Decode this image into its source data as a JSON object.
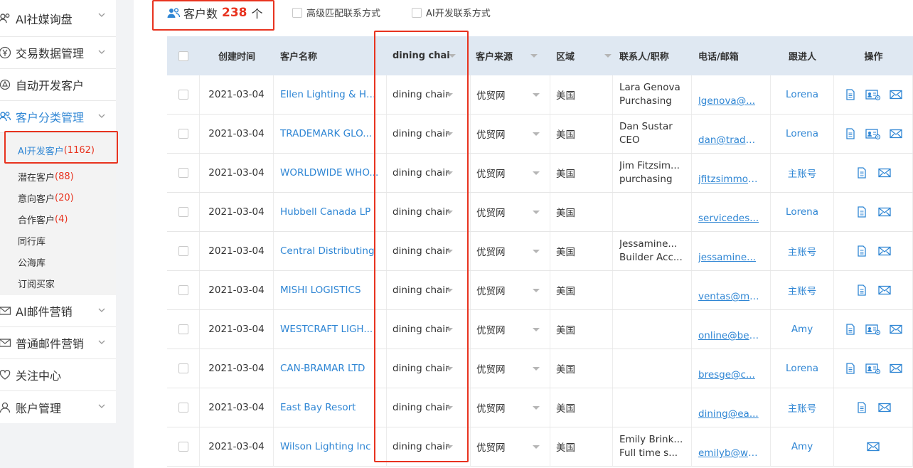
{
  "sidebar": {
    "items": [
      {
        "label": "AI社媒询盘",
        "icon": "users-icon"
      },
      {
        "label": "交易数据管理",
        "icon": "yen-icon"
      },
      {
        "label": "自动开发客户",
        "icon": "refresh-icon"
      },
      {
        "label": "客户分类管理",
        "icon": "group-icon"
      },
      {
        "label": "AI邮件营销",
        "icon": "mail-icon"
      },
      {
        "label": "普通邮件营销",
        "icon": "mail-icon"
      },
      {
        "label": "关注中心",
        "icon": "heart-icon"
      },
      {
        "label": "账户管理",
        "icon": "user-icon"
      }
    ],
    "sub_items": [
      {
        "label": "AI开发客户",
        "count": "(1162)"
      },
      {
        "label": "潜在客户",
        "count": "(88)"
      },
      {
        "label": "意向客户",
        "count": "(20)"
      },
      {
        "label": "合作客户",
        "count": "(4)"
      },
      {
        "label": "同行库",
        "count": ""
      },
      {
        "label": "公海库",
        "count": ""
      },
      {
        "label": "订阅买家",
        "count": ""
      }
    ]
  },
  "topbar": {
    "count_prefix": "客户数",
    "count_value": "238",
    "count_suffix": "个",
    "option1": "高级匹配联系方式",
    "option2": "AI开发联系方式"
  },
  "table": {
    "headers": [
      "创建时间",
      "客户名称",
      "dining chai",
      "客户来源",
      "区域",
      "联系人/职称",
      "电话/邮箱",
      "跟进人",
      "操作"
    ],
    "rows": [
      {
        "date": "2021-03-04",
        "name": "Ellen Lighting & Har...",
        "category": "dining chair",
        "source": "优贸网",
        "region": "美国",
        "contact": "Lara Genova",
        "title": "Purchasing",
        "email": "lgenova@...",
        "follower": "Lorena",
        "actions": [
          "doc-icon",
          "card-icon",
          "mail-icon"
        ]
      },
      {
        "date": "2021-03-04",
        "name": "TRADEMARK GLO...",
        "category": "dining chair",
        "source": "优贸网",
        "region": "美国",
        "contact": "Dan Sustar",
        "title": "CEO",
        "email": "dan@trade...",
        "follower": "Lorena",
        "actions": [
          "doc-icon",
          "card-icon",
          "mail-icon"
        ]
      },
      {
        "date": "2021-03-04",
        "name": "WORLDWIDE WHO...",
        "category": "dining chair",
        "source": "优贸网",
        "region": "美国",
        "contact": "Jim Fitzsim...",
        "title": "purchasing",
        "email": "jfitzsimmon...",
        "follower": "主账号",
        "actions": [
          "doc-icon",
          "mail-icon"
        ]
      },
      {
        "date": "2021-03-04",
        "name": "Hubbell Canada LP",
        "category": "dining chair",
        "source": "优贸网",
        "region": "美国",
        "contact": "",
        "title": "",
        "email": "servicedes...",
        "follower": "Lorena",
        "actions": [
          "doc-icon",
          "mail-icon"
        ]
      },
      {
        "date": "2021-03-04",
        "name": "Central Distributing",
        "category": "dining chair",
        "source": "优贸网",
        "region": "美国",
        "contact": "Jessamine...",
        "title": "Builder Acc...",
        "email": "jessamine...",
        "follower": "主账号",
        "actions": [
          "doc-icon",
          "mail-icon"
        ]
      },
      {
        "date": "2021-03-04",
        "name": "MISHI LOGISTICS",
        "category": "dining chair",
        "source": "优贸网",
        "region": "美国",
        "contact": "",
        "title": "",
        "email": "ventas@mi...",
        "follower": "主账号",
        "actions": [
          "doc-icon",
          "mail-icon"
        ]
      },
      {
        "date": "2021-03-04",
        "name": "WESTCRAFT LIGH...",
        "category": "dining chair",
        "source": "优贸网",
        "region": "美国",
        "contact": "",
        "title": "",
        "email": "online@bel...",
        "follower": "Amy",
        "actions": [
          "doc-icon",
          "card-icon",
          "mail-icon"
        ]
      },
      {
        "date": "2021-03-04",
        "name": "CAN-BRAMAR LTD",
        "category": "dining chair",
        "source": "优贸网",
        "region": "美国",
        "contact": "",
        "title": "",
        "email": "bresge@c...",
        "follower": "Lorena",
        "actions": [
          "doc-icon",
          "card-icon",
          "mail-icon"
        ]
      },
      {
        "date": "2021-03-04",
        "name": "East Bay Resort",
        "category": "dining chair",
        "source": "优贸网",
        "region": "美国",
        "contact": "",
        "title": "",
        "email": "dining@ea...",
        "follower": "主账号",
        "actions": [
          "doc-icon",
          "mail-icon"
        ]
      },
      {
        "date": "2021-03-04",
        "name": "Wilson Lighting Inc",
        "category": "dining chair",
        "source": "优贸网",
        "region": "美国",
        "contact": "Emily Brink...",
        "title": "Full time s...",
        "email": "emilyb@wi...",
        "follower": "Amy",
        "actions": [
          "mail-icon"
        ]
      }
    ]
  },
  "colors": {
    "accent": "#2f86d4",
    "highlight": "#e8331f",
    "header_bg": "#dfe8f2"
  }
}
